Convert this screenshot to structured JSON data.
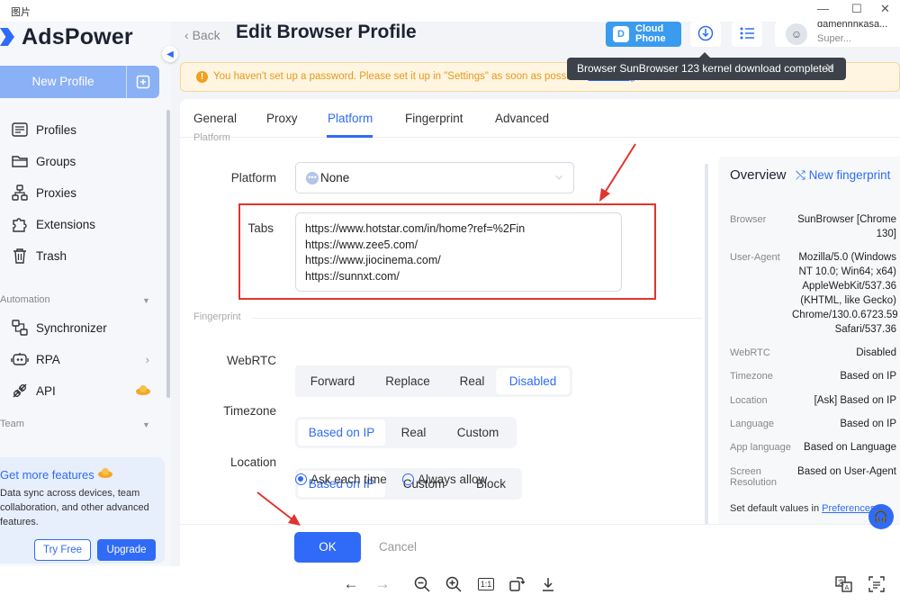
{
  "viewer": {
    "title": "图片",
    "controls": [
      "—",
      "☐",
      "✕"
    ],
    "toolbar": [
      "←",
      "→",
      "zoom-out",
      "zoom-in",
      "1:1",
      "rotate",
      "download"
    ],
    "right_tools": [
      "translate",
      "ocr"
    ]
  },
  "app": {
    "logo": "AdsPower",
    "new_profile": "New Profile",
    "nav": [
      {
        "label": "Profiles",
        "icon": "profiles-icon"
      },
      {
        "label": "Groups",
        "icon": "groups-icon"
      },
      {
        "label": "Proxies",
        "icon": "proxies-icon"
      },
      {
        "label": "Extensions",
        "icon": "extensions-icon"
      },
      {
        "label": "Trash",
        "icon": "trash-icon"
      }
    ],
    "automation_label": "Automation",
    "automation_nav": [
      {
        "label": "Synchronizer",
        "icon": "synchronizer-icon"
      },
      {
        "label": "RPA",
        "icon": "rpa-icon"
      },
      {
        "label": "API",
        "icon": "api-icon"
      }
    ],
    "team_label": "Team",
    "promo": {
      "title": "Get more features",
      "desc": "Data sync across devices, team collaboration, and other advanced features.",
      "try_free": "Try Free",
      "upgrade": "Upgrade"
    }
  },
  "header": {
    "back": "Back",
    "title": "Edit Browser Profile",
    "cloud_line1": "Cloud",
    "cloud_line2": "Phone",
    "user_name": "damenhhkasa...",
    "user_role": "Super..."
  },
  "warning": {
    "text": "You haven't set up a password. Please set it up in \"Settings\" as soon as possible.",
    "link": "Go setting"
  },
  "toast": {
    "text": "Browser SunBrowser 123 kernel download completed"
  },
  "tabs": [
    "General",
    "Proxy",
    "Platform",
    "Fingerprint",
    "Advanced"
  ],
  "active_tab": "Platform",
  "form": {
    "section_platform": "Platform",
    "platform_label": "Platform",
    "platform_value": "None",
    "tabs_label": "Tabs",
    "tabs_urls": [
      "https://www.hotstar.com/in/home?ref=%2Fin",
      "https://www.zee5.com/",
      "https://www.jiocinema.com/",
      "https://sunnxt.com/"
    ],
    "section_fingerprint": "Fingerprint",
    "webrtc_label": "WebRTC",
    "webrtc_options": [
      "Forward",
      "Replace",
      "Real",
      "Disabled"
    ],
    "webrtc_selected": "Disabled",
    "timezone_label": "Timezone",
    "timezone_options": [
      "Based on IP",
      "Real",
      "Custom"
    ],
    "timezone_selected": "Based on IP",
    "location_label": "Location",
    "location_options": [
      "Based on IP",
      "Custom",
      "Block"
    ],
    "location_selected": "Based on IP",
    "location_radio": [
      "Ask each time",
      "Always allow"
    ],
    "location_radio_selected": "Ask each time"
  },
  "overview": {
    "title": "Overview",
    "new_fingerprint": "New fingerprint",
    "rows": [
      {
        "k": "Browser",
        "v": "SunBrowser [Chrome 130]"
      },
      {
        "k": "User-Agent",
        "v": "Mozilla/5.0 (Windows NT 10.0; Win64; x64) AppleWebKit/537.36 (KHTML, like Gecko) Chrome/130.0.6723.59 Safari/537.36"
      },
      {
        "k": "WebRTC",
        "v": "Disabled"
      },
      {
        "k": "Timezone",
        "v": "Based on IP"
      },
      {
        "k": "Location",
        "v": "[Ask] Based on IP"
      },
      {
        "k": "Language",
        "v": "Based on IP"
      },
      {
        "k": "App language",
        "v": "Based on Language"
      },
      {
        "k": "Screen Resolution",
        "v": "Based on User-Agent"
      }
    ],
    "footer_text": "Set default values in",
    "footer_link": "Preferences",
    "footer_end": "."
  },
  "footer": {
    "ok": "OK",
    "cancel": "Cancel"
  },
  "colors": {
    "accent": "#2f6bf6",
    "annotation": "#e0342f",
    "warning": "#e39a1a"
  }
}
